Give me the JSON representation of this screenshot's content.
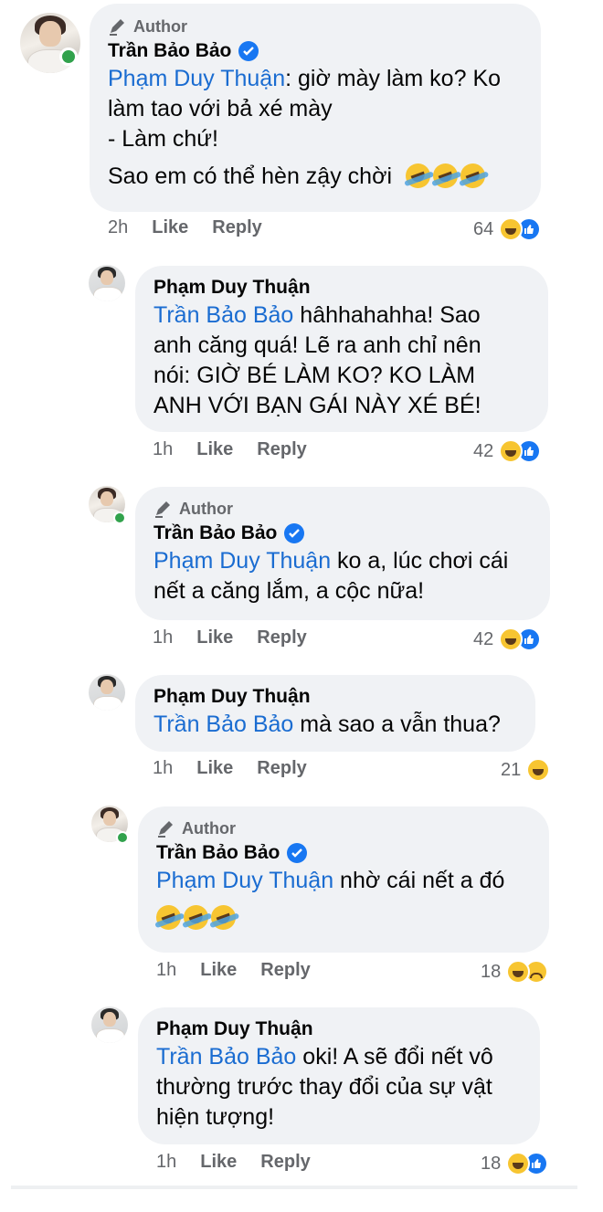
{
  "comments": [
    {
      "author": "Trần Bảo Bảo",
      "badge": "Author",
      "verified": true,
      "mention": "Phạm Duy Thuận",
      "lines": [
        ": giờ mày làm ko? Ko",
        "làm tao với bả xé mày",
        "- Làm chứ!",
        "Sao em có thể hèn zậy chời"
      ],
      "emoji_count": 3,
      "time": "2h",
      "like": "Like",
      "reply": "Reply",
      "reaction_count": "64",
      "reactions": [
        "haha-icon",
        "like-icon"
      ]
    },
    {
      "author": "Phạm Duy Thuận",
      "mention": "Trần Bảo Bảo",
      "lines": [
        " hâhhahahha! Sao",
        "anh căng quá! Lẽ ra anh chỉ nên",
        "nói: GIỜ BÉ LÀM KO? KO LÀM",
        "ANH VỚI BẠN GÁI NÀY XÉ BÉ!"
      ],
      "time": "1h",
      "like": "Like",
      "reply": "Reply",
      "reaction_count": "42",
      "reactions": [
        "haha-icon",
        "like-icon"
      ]
    },
    {
      "author": "Trần Bảo Bảo",
      "badge": "Author",
      "verified": true,
      "mention": "Phạm Duy Thuận",
      "lines": [
        " ko a, lúc chơi cái",
        "nết a căng lắm, a cộc nữa!"
      ],
      "time": "1h",
      "like": "Like",
      "reply": "Reply",
      "reaction_count": "42",
      "reactions": [
        "haha-icon",
        "like-icon"
      ]
    },
    {
      "author": "Phạm Duy Thuận",
      "mention": "Trần Bảo Bảo",
      "lines": [
        " mà sao a vẫn thua?"
      ],
      "time": "1h",
      "like": "Like",
      "reply": "Reply",
      "reaction_count": "21",
      "reactions": [
        "haha-icon"
      ]
    },
    {
      "author": "Trần Bảo Bảo",
      "badge": "Author",
      "verified": true,
      "mention": "Phạm Duy Thuận",
      "lines": [
        " nhờ cái nết a đó"
      ],
      "emoji_count": 3,
      "time": "1h",
      "like": "Like",
      "reply": "Reply",
      "reaction_count": "18",
      "reactions": [
        "haha-icon",
        "sad-icon"
      ]
    },
    {
      "author": "Phạm Duy Thuận",
      "mention": "Trần Bảo Bảo",
      "lines": [
        " oki! A sẽ đổi nết vô",
        "thường trước thay đổi của sự vật",
        "hiện tượng!"
      ],
      "time": "1h",
      "like": "Like",
      "reply": "Reply",
      "reaction_count": "18",
      "reactions": [
        "haha-icon",
        "like-icon"
      ]
    }
  ],
  "colors": {
    "bubble": "#f0f2f5",
    "mention": "#1a6cd1",
    "meta": "#65676b",
    "online": "#31a24c",
    "verified": "#1877f2"
  }
}
